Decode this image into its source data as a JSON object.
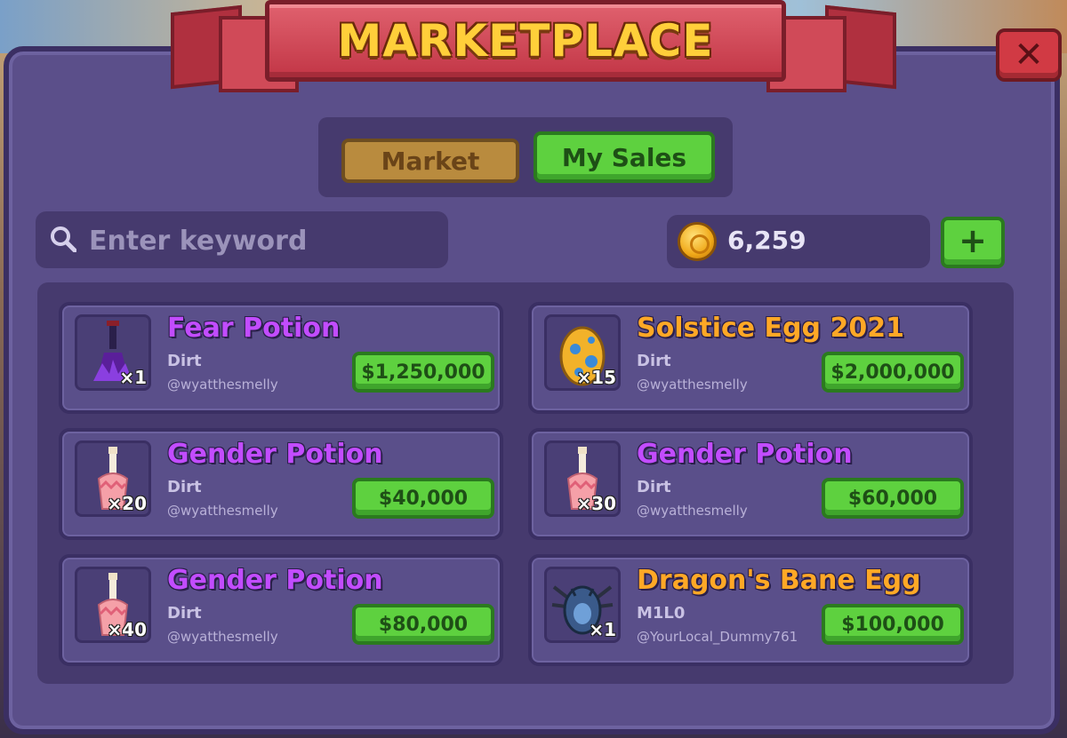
{
  "header": {
    "title": "MARKETPLACE",
    "close_label": "✕"
  },
  "tabs": [
    {
      "label": "Market",
      "active": false
    },
    {
      "label": "My Sales",
      "active": true
    }
  ],
  "search": {
    "placeholder": "Enter keyword",
    "value": ""
  },
  "wallet": {
    "balance": "6,259",
    "add_label": "+"
  },
  "colors": {
    "accent_green": "#5ed13f",
    "panel": "#5b4f8a",
    "rare_purple": "#c24cff",
    "legendary_orange": "#ffa826",
    "banner_red": "#c23646"
  },
  "listings": [
    {
      "name": "Fear Potion",
      "rarity": "purple",
      "subtitle": "Dirt",
      "seller": "@wyatthesmelly",
      "price": "$1,250,000",
      "quantity": "×1",
      "icon": "fear-potion-icon"
    },
    {
      "name": "Solstice Egg 2021",
      "rarity": "orange",
      "subtitle": "Dirt",
      "seller": "@wyatthesmelly",
      "price": "$2,000,000",
      "quantity": "×15",
      "icon": "egg-icon"
    },
    {
      "name": "Gender Potion",
      "rarity": "purple",
      "subtitle": "Dirt",
      "seller": "@wyatthesmelly",
      "price": "$40,000",
      "quantity": "×20",
      "icon": "potion-bottle-icon"
    },
    {
      "name": "Gender Potion",
      "rarity": "purple",
      "subtitle": "Dirt",
      "seller": "@wyatthesmelly",
      "price": "$60,000",
      "quantity": "×30",
      "icon": "potion-bottle-icon"
    },
    {
      "name": "Gender Potion",
      "rarity": "purple",
      "subtitle": "Dirt",
      "seller": "@wyatthesmelly",
      "price": "$80,000",
      "quantity": "×40",
      "icon": "potion-bottle-icon"
    },
    {
      "name": "Dragon's Bane Egg",
      "rarity": "orange",
      "subtitle": "M1L0",
      "seller": "@YourLocal_Dummy761",
      "price": "$100,000",
      "quantity": "×1",
      "icon": "dragon-egg-icon"
    }
  ]
}
